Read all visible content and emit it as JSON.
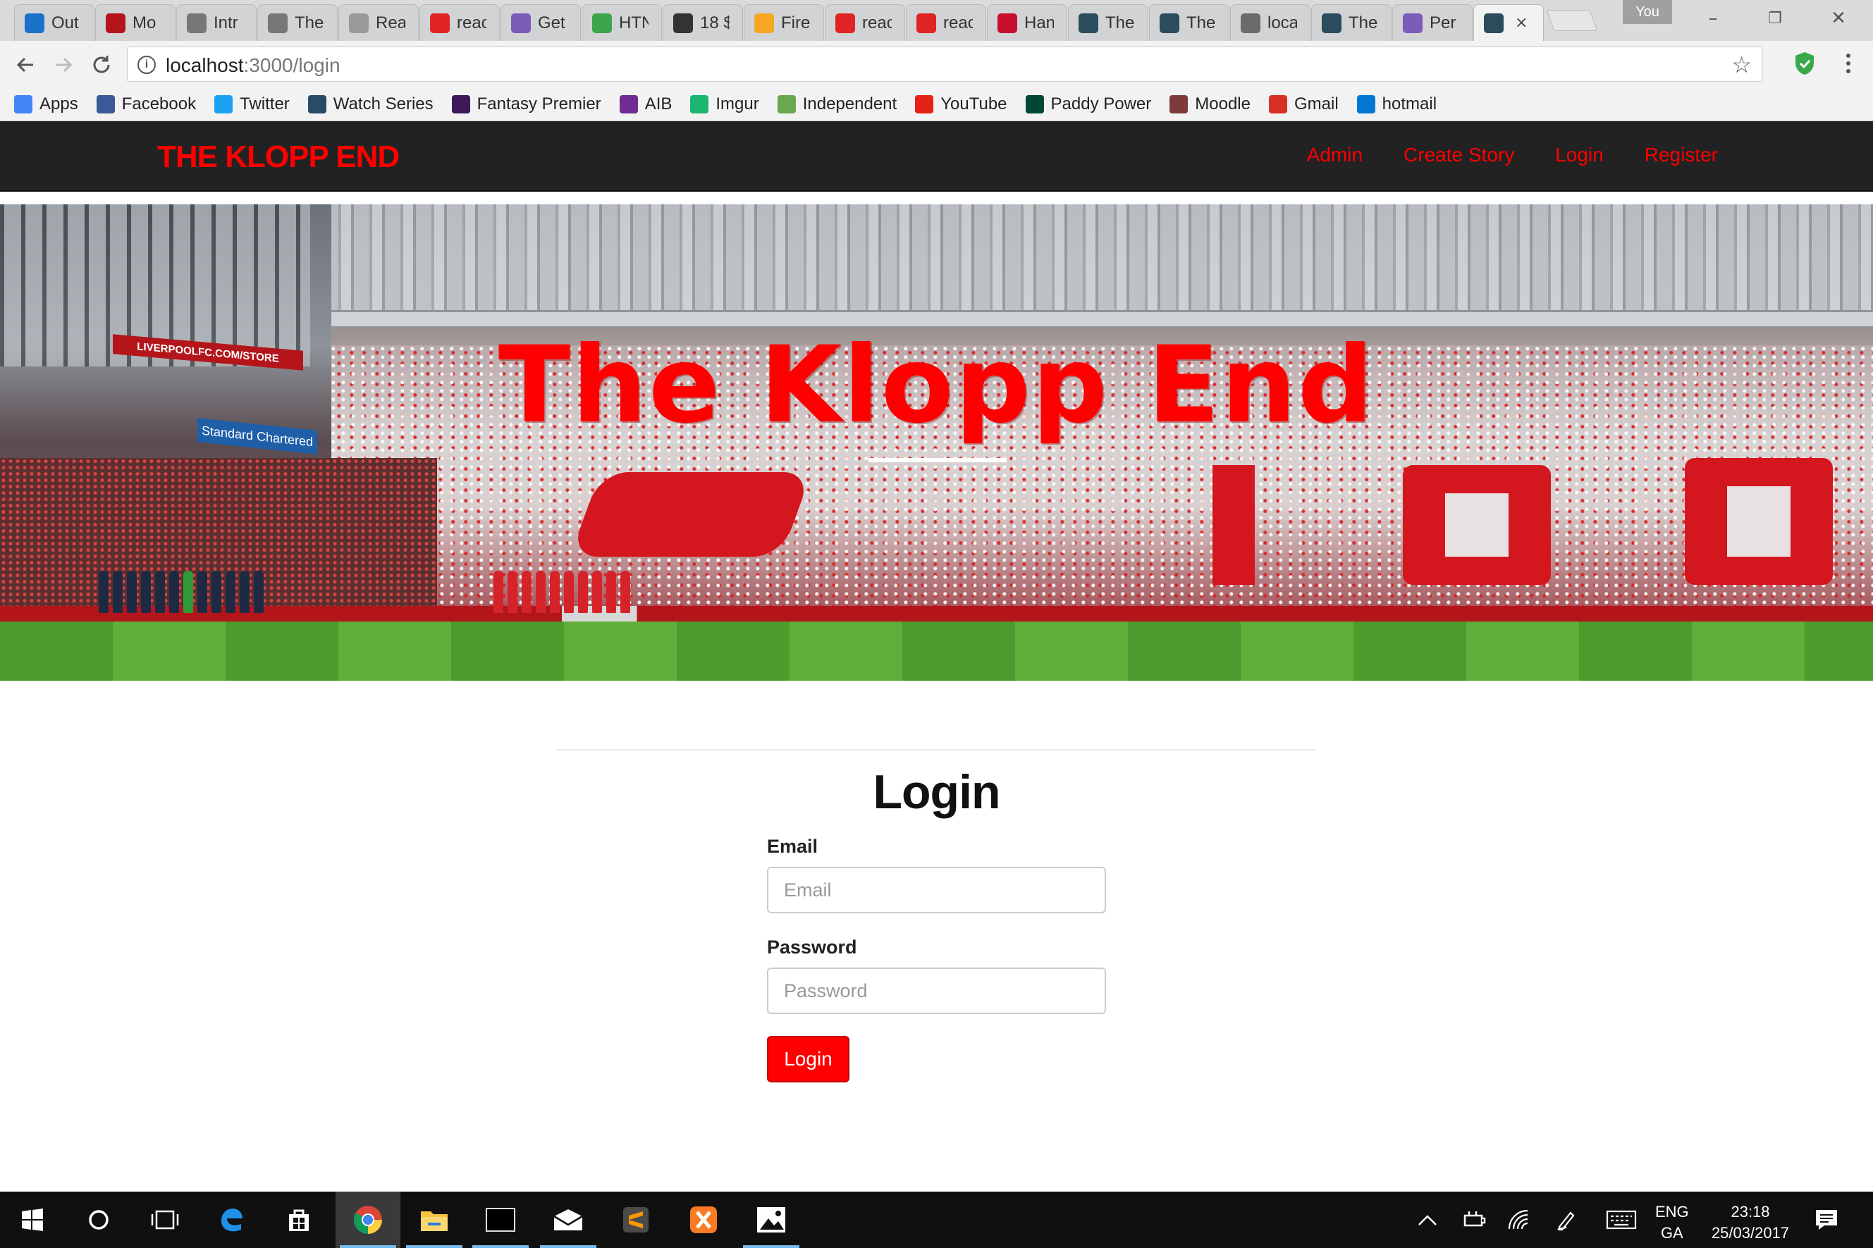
{
  "browser": {
    "tabs": [
      {
        "title": "Out",
        "icon": "outlook-icon",
        "color": "#1a73c9"
      },
      {
        "title": "Mo",
        "icon": "lfc-crest-icon",
        "color": "#b3151b"
      },
      {
        "title": "Intr",
        "icon": "book-icon",
        "color": "#777777"
      },
      {
        "title": "The",
        "icon": "book-icon",
        "color": "#777777"
      },
      {
        "title": "Rea",
        "icon": "lines-icon",
        "color": "#9a9a9a"
      },
      {
        "title": "reac",
        "icon": "bracket-icon",
        "color": "#e02424"
      },
      {
        "title": "Get",
        "icon": "heroku-icon",
        "color": "#7b5cb8"
      },
      {
        "title": "HTN",
        "icon": "html-icon",
        "color": "#3ba64a"
      },
      {
        "title": "18 $",
        "icon": "codepen-icon",
        "color": "#333333"
      },
      {
        "title": "Fire",
        "icon": "firebase-icon",
        "color": "#f6a623"
      },
      {
        "title": "reac",
        "icon": "bracket-icon",
        "color": "#e02424"
      },
      {
        "title": "reac",
        "icon": "bracket-icon",
        "color": "#e02424"
      },
      {
        "title": "Han",
        "icon": "lfc-icon",
        "color": "#c8102e"
      },
      {
        "title": "The",
        "icon": "react-icon",
        "color": "#2b4c5c"
      },
      {
        "title": "The",
        "icon": "react-icon",
        "color": "#2b4c5c"
      },
      {
        "title": "loca",
        "icon": "gear-globe-icon",
        "color": "#6b6b6b"
      },
      {
        "title": "The",
        "icon": "react-icon",
        "color": "#2b4c5c"
      },
      {
        "title": "Per",
        "icon": "heroku-icon",
        "color": "#7b5cb8"
      },
      {
        "title": "",
        "icon": "react-icon",
        "color": "#2b4c5c",
        "active": true
      }
    ],
    "active_tab_close": "×",
    "profile_label": "You",
    "window": {
      "minimize": "–",
      "restore": "❐",
      "close": "✕"
    },
    "url": {
      "host": "localhost",
      "path": ":3000/login"
    }
  },
  "bookmarks": [
    {
      "label": "Apps",
      "icon": "apps-grid-icon",
      "color": "#4285f4"
    },
    {
      "label": "Facebook",
      "icon": "facebook-icon",
      "color": "#3b5998"
    },
    {
      "label": "Twitter",
      "icon": "twitter-icon",
      "color": "#1da1f2"
    },
    {
      "label": "Watch Series",
      "icon": "watch-series-icon",
      "color": "#2a4b66"
    },
    {
      "label": "Fantasy Premier",
      "icon": "premier-league-icon",
      "color": "#3d195b"
    },
    {
      "label": "AIB",
      "icon": "aib-icon",
      "color": "#6f2c91"
    },
    {
      "label": "Imgur",
      "icon": "imgur-icon",
      "color": "#1bb76e"
    },
    {
      "label": "Independent",
      "icon": "independent-icon",
      "color": "#6aa84f"
    },
    {
      "label": "YouTube",
      "icon": "youtube-icon",
      "color": "#e62117"
    },
    {
      "label": "Paddy Power",
      "icon": "paddy-power-icon",
      "color": "#004833"
    },
    {
      "label": "Moodle",
      "icon": "moodle-icon",
      "color": "#7d3c3c"
    },
    {
      "label": "Gmail",
      "icon": "gmail-icon",
      "color": "#d93025"
    },
    {
      "label": "hotmail",
      "icon": "outlook-icon",
      "color": "#0078d4"
    }
  ],
  "site": {
    "brand": "THE KLOPP END",
    "nav": [
      "Admin",
      "Create Story",
      "Login",
      "Register"
    ],
    "hero_title": "The Klopp End",
    "hero_boards": {
      "lfc": "LIVERPOOLFC.COM/STORE",
      "sponsor": "Standard Chartered"
    }
  },
  "login": {
    "heading": "Login",
    "email_label": "Email",
    "email_placeholder": "Email",
    "email_value": "",
    "password_label": "Password",
    "password_placeholder": "Password",
    "password_value": "",
    "submit_label": "Login"
  },
  "taskbar": {
    "language": [
      "ENG",
      "GA"
    ],
    "time": "23:18",
    "date": "25/03/2017",
    "apps": [
      "windows-start-icon",
      "cortana-icon",
      "task-view-icon",
      "edge-icon",
      "store-icon",
      "chrome-icon",
      "file-explorer-icon",
      "terminal-icon",
      "mail-icon",
      "sublime-icon",
      "xampp-icon",
      "photos-icon"
    ]
  }
}
